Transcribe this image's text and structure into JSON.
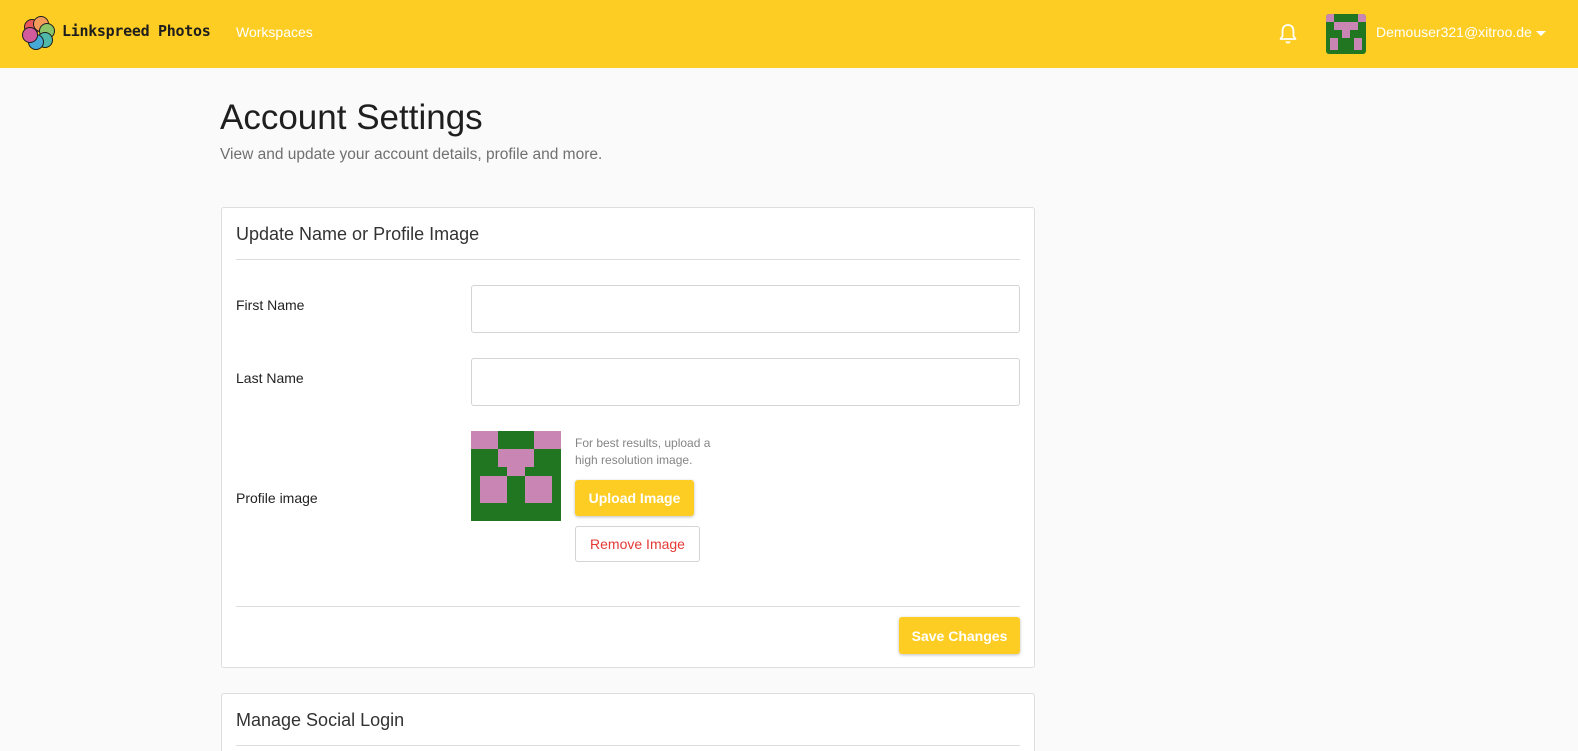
{
  "header": {
    "brand": "Linkspreed Photos",
    "nav_workspaces": "Workspaces",
    "user_email": "Demouser321@xitroo.de",
    "logo_icon": "flower-logo-icon",
    "bell_icon": "bell-icon",
    "caret_icon": "chevron-down-icon"
  },
  "page": {
    "title": "Account Settings",
    "subtitle": "View and update your account details, profile and more."
  },
  "profile_card": {
    "title": "Update Name or Profile Image",
    "first_name_label": "First Name",
    "first_name_value": "",
    "last_name_label": "Last Name",
    "last_name_value": "",
    "profile_image_label": "Profile image",
    "hint": "For best results, upload a high resolution image.",
    "upload_button": "Upload Image",
    "remove_button": "Remove Image",
    "save_button": "Save Changes"
  },
  "social_card": {
    "title": "Manage Social Login"
  },
  "colors": {
    "header_bg": "#fecd23",
    "accent": "#fecd23",
    "danger": "#e53935",
    "avatar_green": "#217721",
    "avatar_pink": "#c986b5"
  }
}
